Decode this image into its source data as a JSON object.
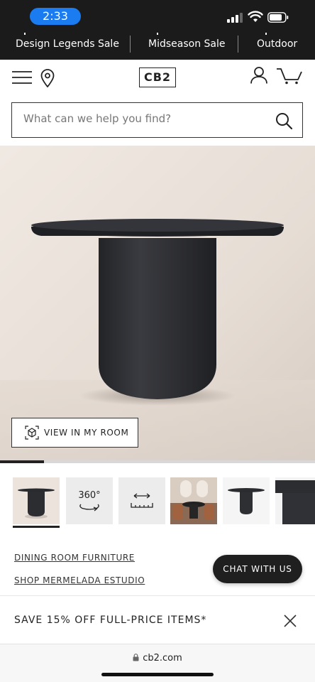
{
  "status_bar": {
    "time": "2:33"
  },
  "promo_nav": {
    "items": [
      {
        "label": "Design Legends Sale"
      },
      {
        "label": "Midseason Sale"
      },
      {
        "label": "Outdoor"
      }
    ]
  },
  "header": {
    "logo": "CB2"
  },
  "search": {
    "placeholder": "What can we help you find?"
  },
  "hero": {
    "view_room_label": "VIEW IN MY ROOM",
    "gallery_progress": 0.14
  },
  "thumbnails": [
    {
      "name": "product-front"
    },
    {
      "name": "360-view",
      "label": "360°"
    },
    {
      "name": "dimensions"
    },
    {
      "name": "room-scene"
    },
    {
      "name": "product-side"
    },
    {
      "name": "product-detail"
    }
  ],
  "links": {
    "dining": "DINING ROOM FURNITURE",
    "shop": "SHOP MERMELADA ESTUDIO"
  },
  "chat": {
    "label": "CHAT WITH US"
  },
  "sale_bar": {
    "text": "SAVE 15% OFF FULL-PRICE ITEMS*"
  },
  "browser": {
    "url": "cb2.com"
  },
  "colors": {
    "brand_dark": "#1b1b1b",
    "time_pill": "#1a7cf0",
    "table": "#2b2c30",
    "backdrop": "#e9e1da"
  }
}
